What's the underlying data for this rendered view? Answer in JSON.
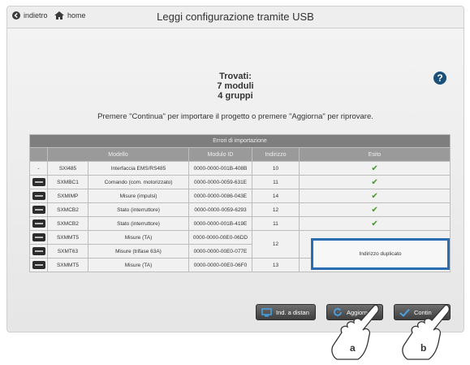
{
  "topbar": {
    "back_label": "indietro",
    "home_label": "home",
    "title": "Leggi configurazione tramite USB"
  },
  "summary": {
    "line1": "Trovati:",
    "line2": "7 moduli",
    "line3": "4 gruppi"
  },
  "help": "?",
  "instruction": "Premere \"Continua\" per importare il progetto o premere \"Aggiorna\" per riprovare.",
  "table": {
    "caption": "Errori di importazione",
    "headers": [
      "",
      "Modello",
      "Modulo ID",
      "Indirizzo",
      "Esito"
    ],
    "rows": [
      {
        "icon": "dash",
        "icon_text": "-",
        "model": "SXI485",
        "desc": "Interfaccia EMS/RS485",
        "id": "0000-0000-001B-408B",
        "addr": "10",
        "ok": true
      },
      {
        "icon": "plug",
        "model": "SXMBC1",
        "desc": "Comando (com. motorizzato)",
        "id": "0000-0000-0059-631E",
        "addr": "11",
        "ok": true
      },
      {
        "icon": "plug",
        "model": "SXMIMP",
        "desc": "Misure (impulsi)",
        "id": "0000-0000-0086-043E",
        "addr": "14",
        "ok": true
      },
      {
        "icon": "plug",
        "model": "SXMCB2",
        "desc": "Stato (interruttore)",
        "id": "0000-0000-0059-6293",
        "addr": "12",
        "ok": true
      },
      {
        "icon": "plug",
        "model": "SXMCB2",
        "desc": "Stato (interruttore)",
        "id": "0000-0000-001B-419E",
        "addr": "11",
        "ok": true
      },
      {
        "icon": "plug",
        "model": "SXMMT5",
        "desc": "Misure (TA)",
        "id": "0000-0000-00E0-06DD",
        "addr": "12",
        "ok": false
      },
      {
        "icon": "plug",
        "model": "SXMT63",
        "desc": "Misure (trifase 63A)",
        "id": "0000-0000-00E0-077E",
        "addr": "",
        "ok": false
      },
      {
        "icon": "plug",
        "model": "SXMMT5",
        "desc": "Misure (TA)",
        "id": "0000-0000-00E0-06F0",
        "addr": "13",
        "ok": true
      }
    ],
    "duplicate_text": "Indirizzo duplicato"
  },
  "buttons": {
    "remote": "Ind. a distan",
    "refresh": "Aggiorn",
    "continue": "Contin"
  },
  "callouts": {
    "a": "a",
    "b": "b"
  },
  "colors": {
    "check": "#3c9a1f",
    "highlight": "#2a6db0",
    "help": "#1c4f7a",
    "button_icon": "#4aa3e6"
  }
}
